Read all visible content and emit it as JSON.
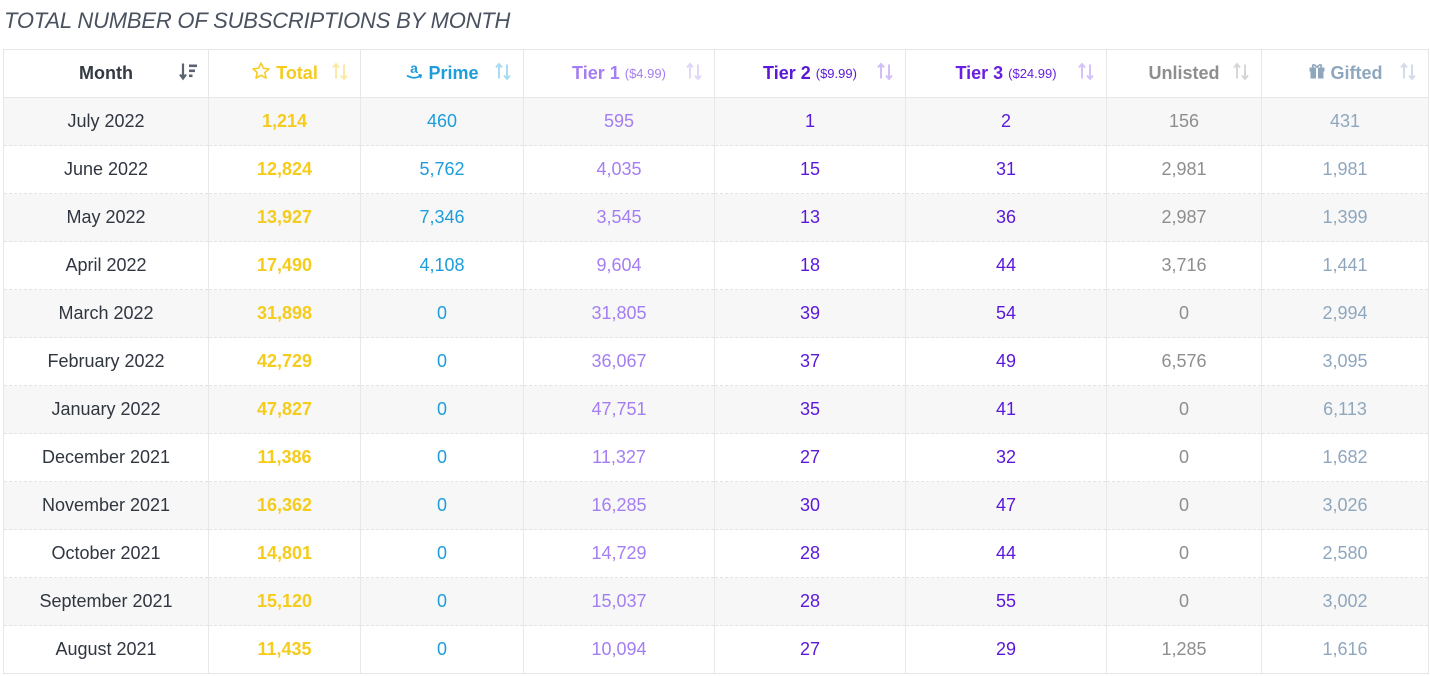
{
  "title": "TOTAL NUMBER OF SUBSCRIPTIONS BY MONTH",
  "colors": {
    "total": "#f5cc1d",
    "prime": "#1d9dd9",
    "tier1": "#a47ef2",
    "tier2": "#5a18d6",
    "tier3": "#6a1fe0",
    "unlisted": "#8e8e8e",
    "gifted": "#8fa7be"
  },
  "columns": {
    "month": {
      "label": "Month",
      "icon": "sort-descending-icon"
    },
    "total": {
      "label": "Total",
      "icon": "star-icon"
    },
    "prime": {
      "label": "Prime",
      "icon": "amazon-icon"
    },
    "tier1": {
      "label": "Tier 1",
      "price": "($4.99)"
    },
    "tier2": {
      "label": "Tier 2",
      "price": "($9.99)"
    },
    "tier3": {
      "label": "Tier 3",
      "price": "($24.99)"
    },
    "unlisted": {
      "label": "Unlisted"
    },
    "gifted": {
      "label": "Gifted",
      "icon": "gift-icon"
    }
  },
  "rows": [
    {
      "month": "July 2022",
      "total": "1,214",
      "prime": "460",
      "tier1": "595",
      "tier2": "1",
      "tier3": "2",
      "unlisted": "156",
      "gifted": "431"
    },
    {
      "month": "June 2022",
      "total": "12,824",
      "prime": "5,762",
      "tier1": "4,035",
      "tier2": "15",
      "tier3": "31",
      "unlisted": "2,981",
      "gifted": "1,981"
    },
    {
      "month": "May 2022",
      "total": "13,927",
      "prime": "7,346",
      "tier1": "3,545",
      "tier2": "13",
      "tier3": "36",
      "unlisted": "2,987",
      "gifted": "1,399"
    },
    {
      "month": "April 2022",
      "total": "17,490",
      "prime": "4,108",
      "tier1": "9,604",
      "tier2": "18",
      "tier3": "44",
      "unlisted": "3,716",
      "gifted": "1,441"
    },
    {
      "month": "March 2022",
      "total": "31,898",
      "prime": "0",
      "tier1": "31,805",
      "tier2": "39",
      "tier3": "54",
      "unlisted": "0",
      "gifted": "2,994"
    },
    {
      "month": "February 2022",
      "total": "42,729",
      "prime": "0",
      "tier1": "36,067",
      "tier2": "37",
      "tier3": "49",
      "unlisted": "6,576",
      "gifted": "3,095"
    },
    {
      "month": "January 2022",
      "total": "47,827",
      "prime": "0",
      "tier1": "47,751",
      "tier2": "35",
      "tier3": "41",
      "unlisted": "0",
      "gifted": "6,113"
    },
    {
      "month": "December 2021",
      "total": "11,386",
      "prime": "0",
      "tier1": "11,327",
      "tier2": "27",
      "tier3": "32",
      "unlisted": "0",
      "gifted": "1,682"
    },
    {
      "month": "November 2021",
      "total": "16,362",
      "prime": "0",
      "tier1": "16,285",
      "tier2": "30",
      "tier3": "47",
      "unlisted": "0",
      "gifted": "3,026"
    },
    {
      "month": "October 2021",
      "total": "14,801",
      "prime": "0",
      "tier1": "14,729",
      "tier2": "28",
      "tier3": "44",
      "unlisted": "0",
      "gifted": "2,580"
    },
    {
      "month": "September 2021",
      "total": "15,120",
      "prime": "0",
      "tier1": "15,037",
      "tier2": "28",
      "tier3": "55",
      "unlisted": "0",
      "gifted": "3,002"
    },
    {
      "month": "August 2021",
      "total": "11,435",
      "prime": "0",
      "tier1": "10,094",
      "tier2": "27",
      "tier3": "29",
      "unlisted": "1,285",
      "gifted": "1,616"
    }
  ]
}
